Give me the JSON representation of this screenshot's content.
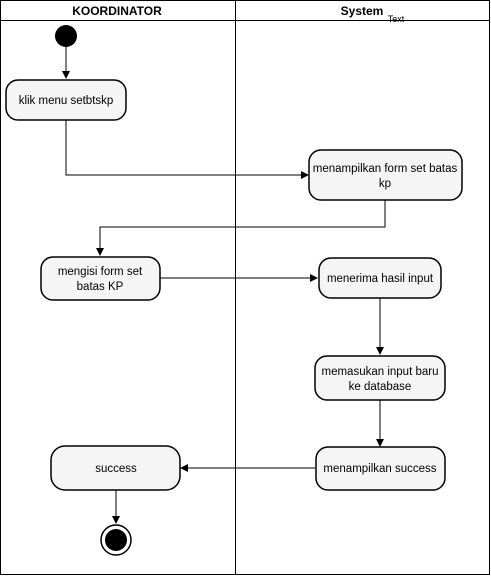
{
  "lanes": {
    "left_title": "KOORDINATOR",
    "right_title": "System",
    "stray_label": "Text"
  },
  "nodes": {
    "klik_menu": "klik menu setbtskp",
    "tampil_form": [
      "menampilkan form set batas",
      "kp"
    ],
    "mengisi_form": [
      "mengisi form set",
      "batas KP"
    ],
    "menerima_input": "menerima hasil input",
    "memasukan_input": [
      "memasukan input baru",
      "ke database"
    ],
    "tampil_success": "menampilkan success",
    "success": "success"
  },
  "colors": {
    "node_fill": "#f5f5f5",
    "stroke": "#000000"
  }
}
